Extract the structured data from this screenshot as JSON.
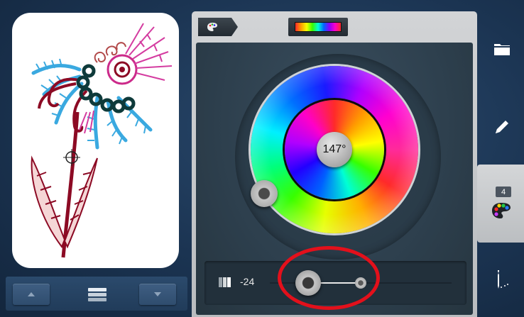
{
  "color_wheel": {
    "hue_value": "147°"
  },
  "brightness": {
    "value": "-24"
  },
  "sidebar": {
    "items": [
      {
        "name": "folder-icon"
      },
      {
        "name": "pencil-icon"
      },
      {
        "name": "palette-icon",
        "badge": "4"
      },
      {
        "name": "needle-icon"
      }
    ]
  },
  "colors": {
    "annotation": "#e3101b",
    "panel": "#c6c8ca",
    "work_area": "#2d3f4d"
  }
}
